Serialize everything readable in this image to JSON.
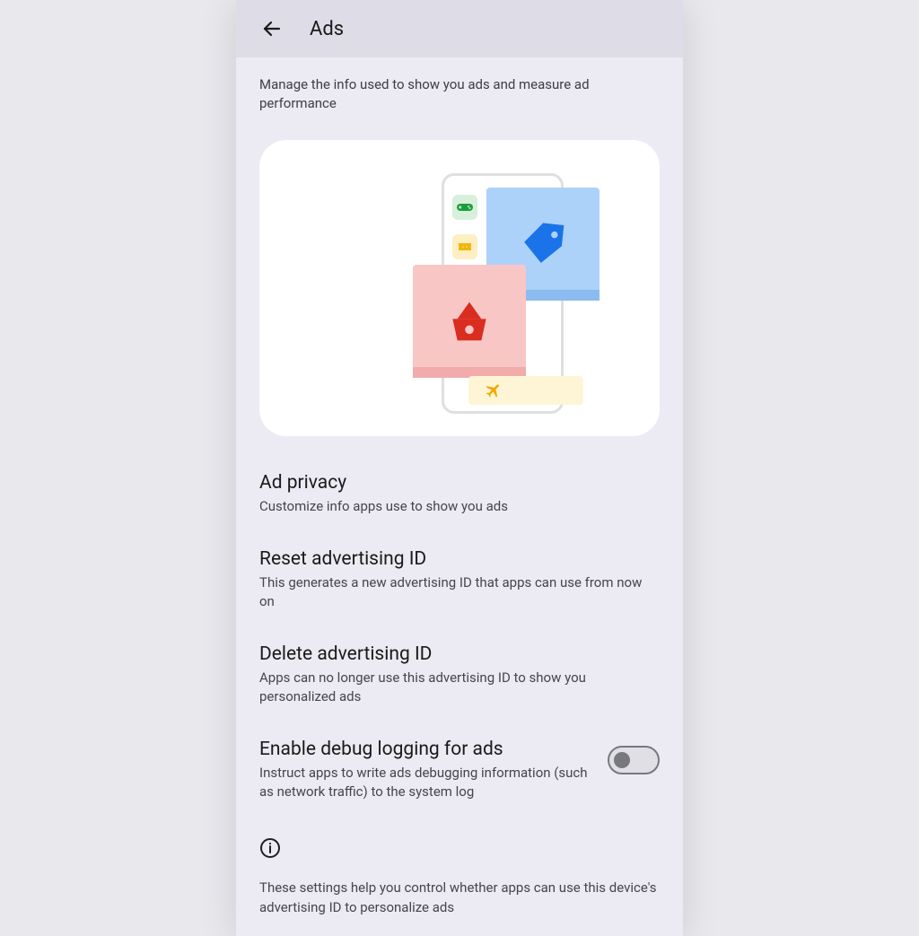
{
  "header": {
    "title": "Ads"
  },
  "intro": "Manage the info used to show you ads and measure ad performance",
  "settings": {
    "ad_privacy": {
      "title": "Ad privacy",
      "desc": "Customize info apps use to show you ads"
    },
    "reset_id": {
      "title": "Reset advertising ID",
      "desc": "This generates a new advertising ID that apps can use from now on"
    },
    "delete_id": {
      "title": "Delete advertising ID",
      "desc": "Apps can no longer use this advertising ID to show you personalized ads"
    },
    "debug_logging": {
      "title": "Enable debug logging for ads",
      "desc": "Instruct apps to write ads debugging information (such as network traffic) to the system log",
      "enabled": false
    }
  },
  "footer": {
    "text": "These settings help you control whether apps can use this device's advertising ID to personalize ads"
  }
}
